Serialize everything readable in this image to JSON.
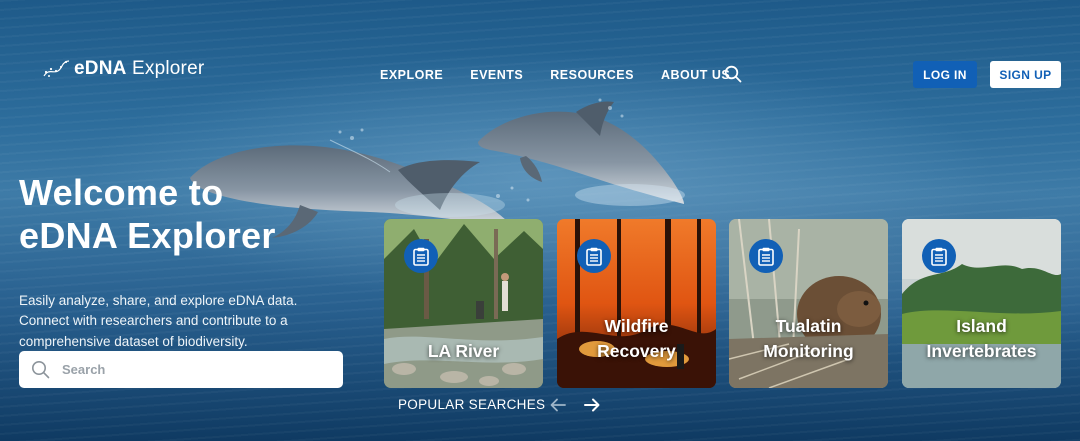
{
  "header": {
    "logo_prefix": "eDNA",
    "logo_suffix": " Explorer",
    "nav": [
      "EXPLORE",
      "EVENTS",
      "RESOURCES",
      "ABOUT US"
    ],
    "login_label": "LOG IN",
    "signup_label": "SIGN UP"
  },
  "hero": {
    "title_line1": "Welcome to",
    "title_line2": "eDNA Explorer",
    "subtitle": "Easily analyze, share, and explore eDNA data. Connect with researchers and contribute to a comprehensive dataset of biodiversity."
  },
  "search": {
    "placeholder": "Search"
  },
  "cards": [
    {
      "line1": "LA River",
      "line2": ""
    },
    {
      "line1": "Wildfire",
      "line2": "Recovery"
    },
    {
      "line1": "Tualatin",
      "line2": "Monitoring"
    },
    {
      "line1": "Island",
      "line2": "Invertebrates"
    }
  ],
  "popular": {
    "label": "POPULAR SEARCHES"
  },
  "colors": {
    "primary": "#1160b6",
    "ocean": "#1e5a89",
    "white": "#ffffff"
  },
  "icons": {
    "search": "magnifier-icon",
    "card_badge": "clipboard-icon",
    "prev": "arrow-left-icon",
    "next": "arrow-right-icon"
  }
}
